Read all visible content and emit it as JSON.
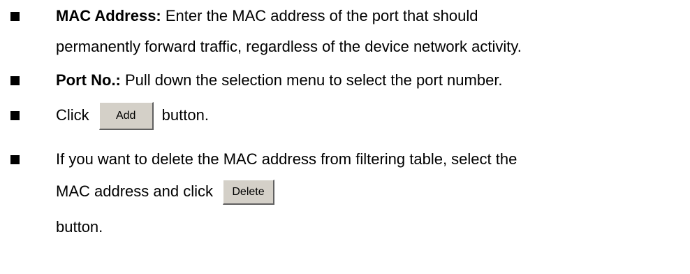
{
  "items": [
    {
      "term": "MAC Address:",
      "line1_text": " Enter the MAC address of the port that should",
      "line2_text": "permanently forward traffic, regardless of the device network activity."
    },
    {
      "term": "Port No.:",
      "line1_text": " Pull down the selection menu to select the port number."
    },
    {
      "prefix": "Click",
      "button_label": "Add",
      "suffix": "button."
    },
    {
      "line1_text": "If you want to delete the MAC address from filtering table, select the",
      "line2_prefix": "MAC address and click",
      "button_label": "Delete",
      "line3_text": "button."
    }
  ]
}
